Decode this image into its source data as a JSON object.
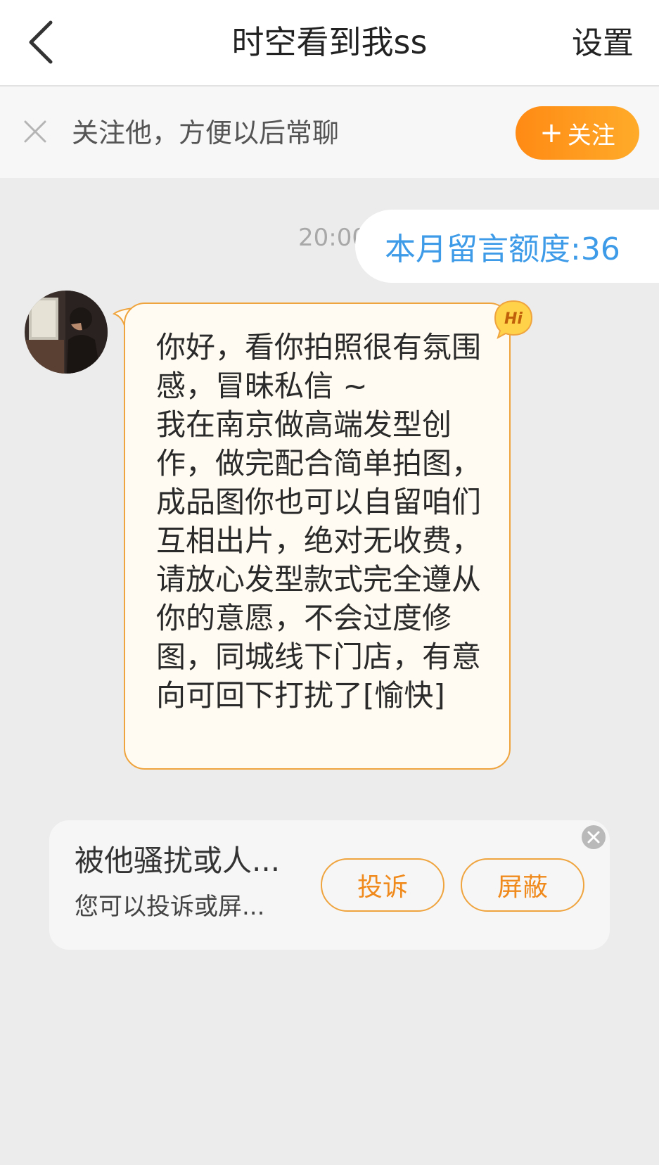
{
  "header": {
    "title": "时空看到我ss",
    "settings_label": "设置",
    "back_icon": "chevron-left-icon"
  },
  "follow_bar": {
    "close_icon": "close-icon",
    "text": "关注他，方便以后常聊",
    "button_plus": "+",
    "button_label": "关注"
  },
  "chat": {
    "timestamp": "20:00",
    "quota_text": "本月留言额度:36",
    "message": {
      "text": "你好，看你拍照很有氛围感，冒昧私信 ~\n我在南京做高端发型创作，做完配合简单拍图，成品图你也可以自留咱们互相出片，绝对无收费，请放心发型款式完全遵从你的意愿，不会过度修图，同城线下门店，有意向可回下打扰了[愉快]",
      "badge_text": "Hi"
    }
  },
  "report_card": {
    "title": "被他骚扰或人...",
    "subtitle": "您可以投诉或屏...",
    "complain_label": "投诉",
    "block_label": "屏蔽"
  },
  "colors": {
    "accent_orange": "#ff8a14",
    "quota_blue": "#3d9be8",
    "background": "#ececec"
  }
}
